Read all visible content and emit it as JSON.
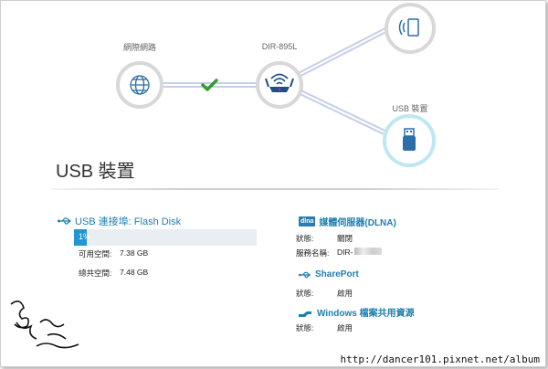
{
  "topology": {
    "internet_label": "網際網路",
    "router_label": "DIR-895L",
    "usb_label": "USB 裝置"
  },
  "page_title": "USB 裝置",
  "usb": {
    "connect_label": "USB 連接埠: Flash Disk",
    "percent": "1%",
    "percent_value": 0.01,
    "available_label": "可用空間:",
    "available_value": "7.38 GB",
    "total_label": "總共空間:",
    "total_value": "7.48 GB"
  },
  "services": {
    "dlna_badge": "dlna",
    "dlna_title": "媒體伺服器(DLNA)",
    "dlna_status_label": "狀態:",
    "dlna_status_value": "關閉",
    "dlna_name_label": "服務名稱:",
    "dlna_name_value": "DIR-",
    "sharepoint_title": "SharePort",
    "sharepoint_status_label": "狀態:",
    "sharepoint_status_value": "啟用",
    "windows_title": "Windows 檔案共用資源",
    "windows_status_label": "狀態:",
    "windows_status_value": "啟用"
  },
  "watermark": "http://dancer101.pixnet.net/album",
  "colors": {
    "accent": "#2196d3",
    "link": "#1e7fb0",
    "check": "#2e9e2e"
  }
}
